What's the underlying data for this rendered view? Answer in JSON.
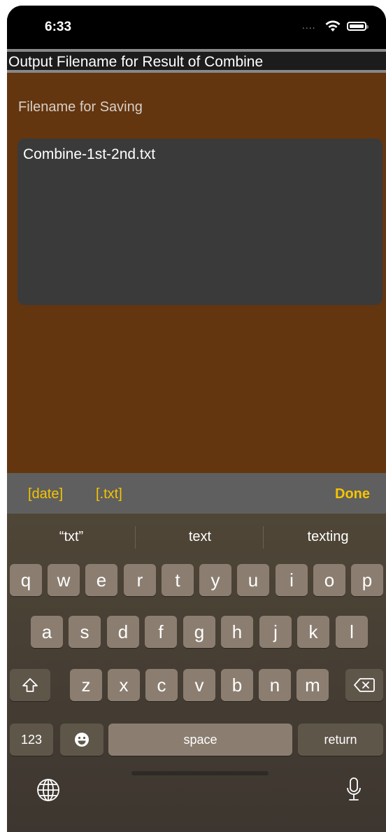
{
  "status": {
    "time": "6:33",
    "signal": "....",
    "wifi_icon": "wifi-icon",
    "battery_icon": "battery-icon"
  },
  "nav": {
    "title": "Output Filename for Result of Combine"
  },
  "form": {
    "label": "Filename for Saving",
    "value": "Combine-1st-2nd.txt"
  },
  "accessory": {
    "date": "[date]",
    "txt": "[.txt]",
    "done": "Done",
    "accent": "#f5c400"
  },
  "suggestions": [
    "“txt”",
    "text",
    "texting"
  ],
  "keyboard": {
    "row1": [
      "q",
      "w",
      "e",
      "r",
      "t",
      "y",
      "u",
      "i",
      "o",
      "p"
    ],
    "row2": [
      "a",
      "s",
      "d",
      "f",
      "g",
      "h",
      "j",
      "k",
      "l"
    ],
    "row3": [
      "z",
      "x",
      "c",
      "v",
      "b",
      "n",
      "m"
    ],
    "numbers": "123",
    "space": "space",
    "return": "return"
  },
  "colors": {
    "background": "#633610",
    "textbox": "#3a3a3a",
    "accessory_bar": "#5f5f5f"
  }
}
